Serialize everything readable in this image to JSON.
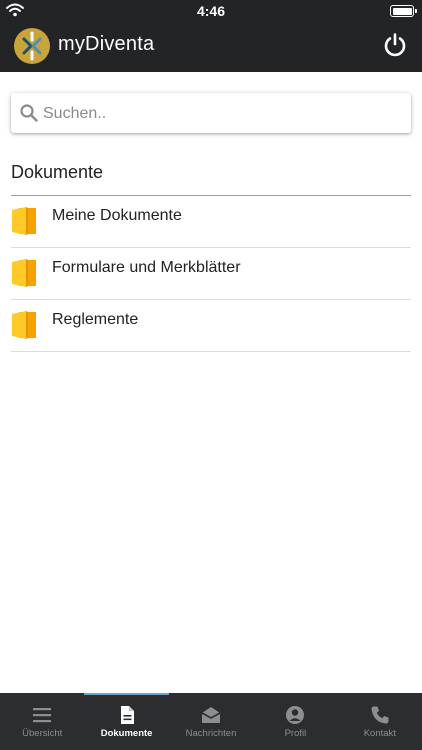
{
  "status_bar": {
    "time": "4:46"
  },
  "header": {
    "app_title": "myDiventa"
  },
  "search": {
    "placeholder": "Suchen.."
  },
  "section": {
    "title": "Dokumente"
  },
  "documents": [
    {
      "label": "Meine Dokumente"
    },
    {
      "label": "Formulare und Merkblätter"
    },
    {
      "label": "Reglemente"
    }
  ],
  "bottom_nav": [
    {
      "label": "Übersicht",
      "icon": "menu-icon",
      "active": false
    },
    {
      "label": "Dokumente",
      "icon": "document-icon",
      "active": true
    },
    {
      "label": "Nachrichten",
      "icon": "envelope-open-icon",
      "active": false
    },
    {
      "label": "Profil",
      "icon": "user-circle-icon",
      "active": false
    },
    {
      "label": "Kontakt",
      "icon": "phone-icon",
      "active": false
    }
  ],
  "colors": {
    "header_bg": "#222426",
    "bottom_nav_bg": "#2b2d2f",
    "folder_yellow": "#f4b400",
    "logo_gold": "#c9a43b",
    "active_indicator": "#5fa8d3"
  }
}
